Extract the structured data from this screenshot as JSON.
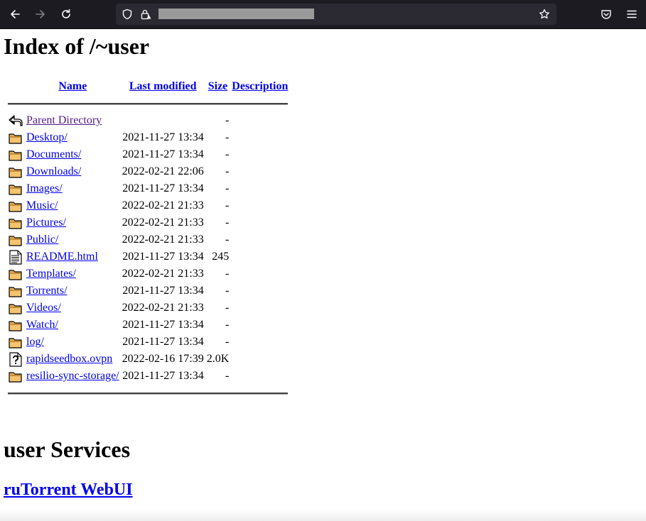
{
  "browser": {
    "back_icon": "arrow-left-icon",
    "forward_icon": "arrow-right-icon",
    "reload_icon": "reload-icon",
    "shield_icon": "shield-icon",
    "lock_icon": "lock-warning-icon",
    "bookmark_icon": "star-icon",
    "pocket_icon": "pocket-icon",
    "menu_icon": "hamburger-menu-icon",
    "chrome_color": "#1c1b22",
    "urlbar_color": "#2b2a33"
  },
  "page": {
    "title": "Index of /~user",
    "columns": {
      "name": "Name",
      "last_modified": "Last modified",
      "size": "Size",
      "description": "Description"
    },
    "parent": {
      "name": "Parent Directory",
      "size": "-",
      "icon": "back-icon"
    },
    "entries": [
      {
        "name": "Desktop/",
        "date": "2021-11-27 13:34",
        "size": "-",
        "icon": "folder-icon"
      },
      {
        "name": "Documents/",
        "date": "2021-11-27 13:34",
        "size": "-",
        "icon": "folder-icon"
      },
      {
        "name": "Downloads/",
        "date": "2022-02-21 22:06",
        "size": "-",
        "icon": "folder-icon"
      },
      {
        "name": "Images/",
        "date": "2021-11-27 13:34",
        "size": "-",
        "icon": "folder-icon"
      },
      {
        "name": "Music/",
        "date": "2022-02-21 21:33",
        "size": "-",
        "icon": "folder-icon"
      },
      {
        "name": "Pictures/",
        "date": "2022-02-21 21:33",
        "size": "-",
        "icon": "folder-icon"
      },
      {
        "name": "Public/",
        "date": "2022-02-21 21:33",
        "size": "-",
        "icon": "folder-icon"
      },
      {
        "name": "README.html",
        "date": "2021-11-27 13:34",
        "size": "245",
        "icon": "text-file-icon"
      },
      {
        "name": "Templates/",
        "date": "2022-02-21 21:33",
        "size": "-",
        "icon": "folder-icon"
      },
      {
        "name": "Torrents/",
        "date": "2021-11-27 13:34",
        "size": "-",
        "icon": "folder-icon"
      },
      {
        "name": "Videos/",
        "date": "2022-02-21 21:33",
        "size": "-",
        "icon": "folder-icon"
      },
      {
        "name": "Watch/",
        "date": "2021-11-27 13:34",
        "size": "-",
        "icon": "folder-icon"
      },
      {
        "name": "log/",
        "date": "2021-11-27 13:34",
        "size": "-",
        "icon": "folder-icon"
      },
      {
        "name": "rapidseedbox.ovpn",
        "date": "2022-02-16 17:39",
        "size": "2.0K",
        "icon": "unknown-file-icon"
      },
      {
        "name": "resilio-sync-storage/",
        "date": "2021-11-27 13:34",
        "size": "-",
        "icon": "folder-icon"
      }
    ],
    "services_heading": "user Services",
    "webui_link": "ruTorrent WebUI",
    "link_color": "#0000ee",
    "visited_color": "#551a8b"
  }
}
